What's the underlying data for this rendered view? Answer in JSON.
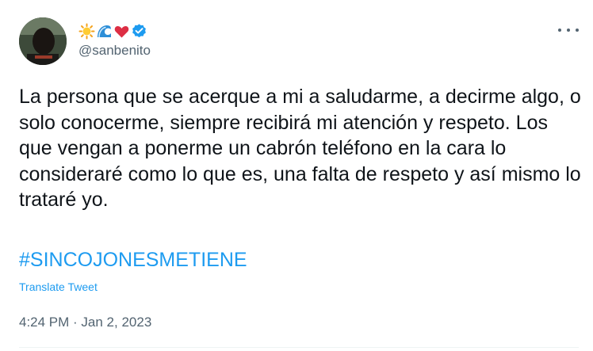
{
  "author": {
    "display_name_icons": [
      "sun-emoji",
      "wave-emoji",
      "red-heart-emoji",
      "verified-badge-icon"
    ],
    "handle": "@sanbenito",
    "verified": true
  },
  "tweet": {
    "text": "La persona que se acerque a mi a saludarme, a decirme algo, o solo conocerme, siempre recibirá mi atención y respeto. Los que vengan a ponerme un cabrón teléfono en la cara lo consideraré como lo que es, una falta de respeto y así mismo lo trataré yo.",
    "hashtag": "#SINCOJONESMETIENE",
    "translate_label": "Translate Tweet",
    "timestamp": "4:24 PM · Jan 2, 2023"
  },
  "menu": {
    "icon": "more-horizontal-icon"
  },
  "colors": {
    "link": "#1d9bf0",
    "secondary_text": "#536471",
    "primary_text": "#0f1419",
    "verified": "#1d9bf0",
    "heart": "#f91880"
  }
}
